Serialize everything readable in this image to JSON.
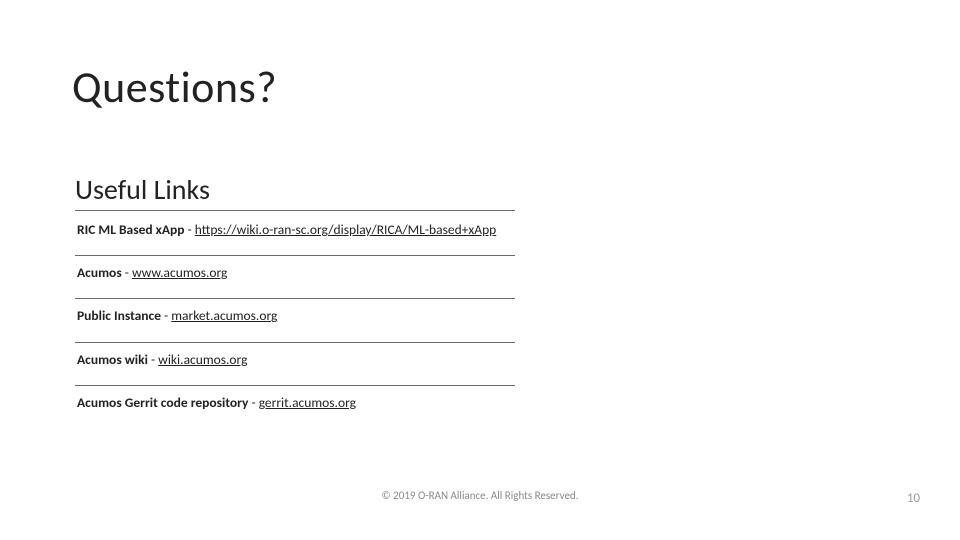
{
  "title": "Questions?",
  "subtitle": "Useful Links",
  "links": [
    {
      "label": "RIC ML Based xApp",
      "sep": " - ",
      "url": "https://wiki.o-ran-sc.org/display/RICA/ML-based+xApp"
    },
    {
      "label": "Acumos",
      "sep": " - ",
      "url": "www.acumos.org"
    },
    {
      "label": "Public Instance",
      "sep": " - ",
      "url": "market.acumos.org"
    },
    {
      "label": "Acumos wiki",
      "sep": " - ",
      "url": "wiki.acumos.org"
    },
    {
      "label": "Acumos Gerrit code repository",
      "sep": " - ",
      "url": "gerrit.acumos.org"
    }
  ],
  "footer": "© 2019 O-RAN Alliance. All Rights Reserved.",
  "page": "10"
}
